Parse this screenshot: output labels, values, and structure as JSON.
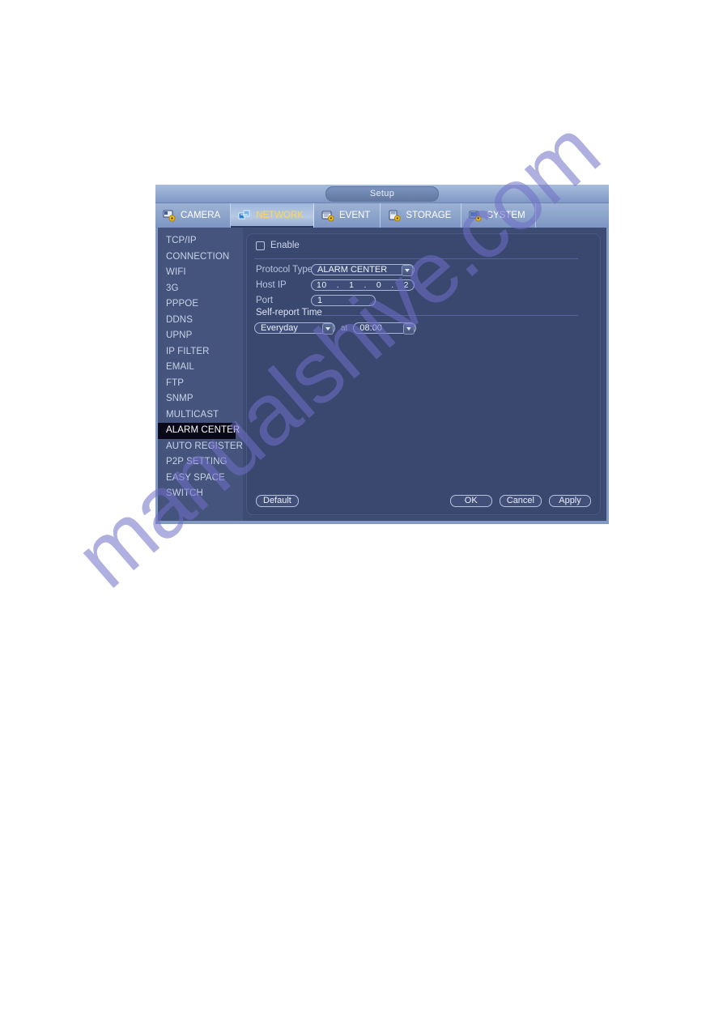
{
  "window": {
    "title": "Setup"
  },
  "tabs": [
    {
      "label": "CAMERA",
      "icon": "camera-gear-icon",
      "active": false
    },
    {
      "label": "NETWORK",
      "icon": "network-icon",
      "active": true
    },
    {
      "label": "EVENT",
      "icon": "event-gear-icon",
      "active": false
    },
    {
      "label": "STORAGE",
      "icon": "storage-gear-icon",
      "active": false
    },
    {
      "label": "SYSTEM",
      "icon": "system-gear-icon",
      "active": false
    }
  ],
  "sidebar": {
    "items": [
      {
        "label": "TCP/IP",
        "selected": false
      },
      {
        "label": "CONNECTION",
        "selected": false
      },
      {
        "label": "WIFI",
        "selected": false
      },
      {
        "label": "3G",
        "selected": false
      },
      {
        "label": "PPPOE",
        "selected": false
      },
      {
        "label": "DDNS",
        "selected": false
      },
      {
        "label": "UPNP",
        "selected": false
      },
      {
        "label": "IP FILTER",
        "selected": false
      },
      {
        "label": "EMAIL",
        "selected": false
      },
      {
        "label": "FTP",
        "selected": false
      },
      {
        "label": "SNMP",
        "selected": false
      },
      {
        "label": "MULTICAST",
        "selected": false
      },
      {
        "label": "ALARM CENTER",
        "selected": true
      },
      {
        "label": "AUTO REGISTER",
        "selected": false
      },
      {
        "label": "P2P SETTING",
        "selected": false
      },
      {
        "label": "EASY SPACE",
        "selected": false
      },
      {
        "label": "SWITCH",
        "selected": false
      }
    ]
  },
  "form": {
    "enable_label": "Enable",
    "enable_checked": false,
    "protocol_type_label": "Protocol Type",
    "protocol_type_value": "ALARM CENTER",
    "host_ip_label": "Host IP",
    "host_ip_octets": [
      "10",
      "1",
      "0",
      "2"
    ],
    "host_ip_separator": ".",
    "port_label": "Port",
    "port_value": "1",
    "self_report_time_label": "Self-report Time",
    "day_value": "Everyday",
    "at_label": "at",
    "time_value": "08:00"
  },
  "buttons": {
    "default": "Default",
    "ok": "OK",
    "cancel": "Cancel",
    "apply": "Apply"
  },
  "watermark": {
    "text": "manualshive.com",
    "color": "#6f6fc8"
  }
}
